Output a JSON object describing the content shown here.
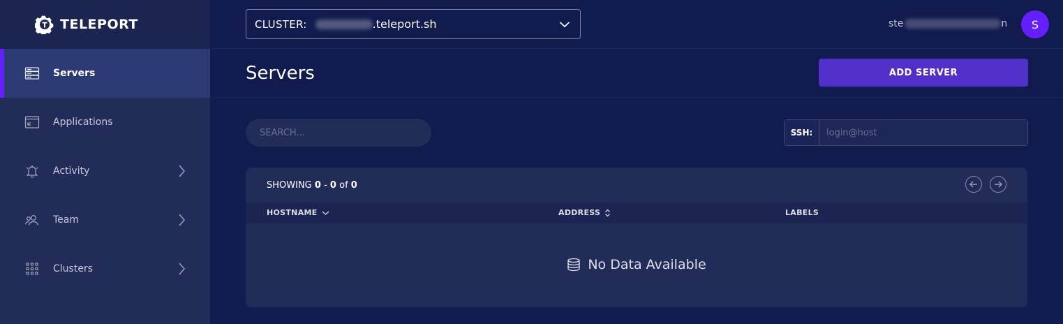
{
  "brand": {
    "name": "TELEPORT"
  },
  "sidebar": {
    "items": [
      {
        "label": "Servers",
        "icon": "server-icon",
        "active": true
      },
      {
        "label": "Applications",
        "icon": "application-icon"
      },
      {
        "label": "Activity",
        "icon": "bell-icon",
        "expandable": true
      },
      {
        "label": "Team",
        "icon": "users-icon",
        "expandable": true
      },
      {
        "label": "Clusters",
        "icon": "grid-icon",
        "expandable": true
      }
    ]
  },
  "topbar": {
    "cluster_label": "CLUSTER:",
    "cluster_value": ".teleport.sh",
    "user_prefix": "ste",
    "user_suffix": "n",
    "avatar_initial": "S"
  },
  "header": {
    "title": "Servers",
    "add_button": "ADD SERVER"
  },
  "search": {
    "placeholder": "SEARCH..."
  },
  "ssh": {
    "label": "SSH:",
    "placeholder": "login@host"
  },
  "table": {
    "showing_prefix": "SHOWING",
    "range_start": "0",
    "range_sep": "-",
    "range_end": "0",
    "of_label": "of",
    "total": "0",
    "columns": [
      "HOSTNAME",
      "ADDRESS",
      "LABELS"
    ],
    "empty_message": "No Data Available"
  },
  "colors": {
    "background": "#111b4d",
    "sidebar": "#222c59",
    "accent": "#651fff",
    "button": "#512fc9"
  }
}
